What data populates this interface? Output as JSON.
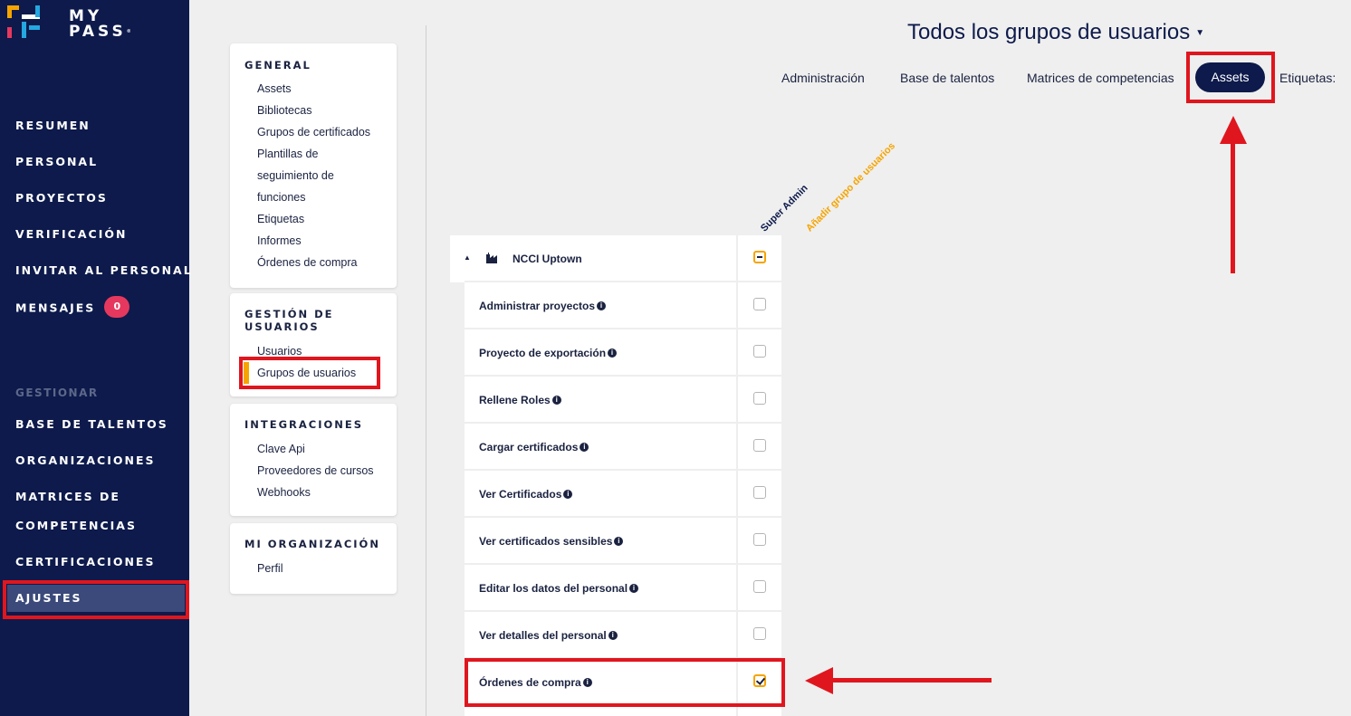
{
  "app": {
    "logo_line1": "MY",
    "logo_line2": "PASS"
  },
  "sidebar": {
    "items": [
      {
        "label": "RESUMEN"
      },
      {
        "label": "PERSONAL"
      },
      {
        "label": "PROYECTOS"
      },
      {
        "label": "VERIFICACIÓN"
      },
      {
        "label": "INVITAR AL PERSONAL"
      },
      {
        "label": "MENSAJES",
        "badge": "0"
      }
    ],
    "section_label": "GESTIONAR",
    "manage_items": [
      {
        "label": "BASE DE TALENTOS"
      },
      {
        "label": "ORGANIZACIONES"
      },
      {
        "label": "MATRICES DE"
      },
      {
        "label": "COMPETENCIAS"
      },
      {
        "label": "CERTIFICACIONES"
      },
      {
        "label": "AJUSTES",
        "active": true
      }
    ]
  },
  "settings_menu": {
    "general": {
      "title": "GENERAL",
      "links": [
        "Assets",
        "Bibliotecas",
        "Grupos de certificados",
        "Plantillas de",
        "seguimiento de",
        "funciones",
        "Etiquetas",
        "Informes",
        "Órdenes de compra"
      ]
    },
    "user_management": {
      "title_line1": "GESTIÓN DE",
      "title_line2": "USUARIOS",
      "links": [
        "Usuarios",
        "Grupos de usuarios"
      ],
      "active_link": "Grupos de usuarios"
    },
    "integrations": {
      "title": "INTEGRACIONES",
      "links": [
        "Clave Api",
        "Proveedores de cursos",
        "Webhooks"
      ]
    },
    "my_organization": {
      "title": "MI ORGANIZACIÓN",
      "links": [
        "Perfil"
      ]
    }
  },
  "header": {
    "title": "Todos los grupos de usuarios",
    "tabs": [
      "Administración",
      "Base de talentos",
      "Matrices de competencias",
      "Assets",
      "Etiquetas:"
    ],
    "active_tab": "Assets"
  },
  "permissions": {
    "columns": [
      "Super Admin",
      "Añadir grupo de usuarios"
    ],
    "group": {
      "name": "NCCI Uptown",
      "state": "indeterminate"
    },
    "rows": [
      {
        "label": "Administrar proyectos",
        "checked": false
      },
      {
        "label": "Proyecto de exportación",
        "checked": false
      },
      {
        "label": "Rellene Roles",
        "checked": false
      },
      {
        "label": "Cargar certificados",
        "checked": false
      },
      {
        "label": "Ver Certificados",
        "checked": false
      },
      {
        "label": "Ver certificados sensibles",
        "checked": false
      },
      {
        "label": "Editar los datos del personal",
        "checked": false
      },
      {
        "label": "Ver detalles del personal",
        "checked": false
      },
      {
        "label": "Órdenes de compra",
        "checked": true
      }
    ]
  },
  "colors": {
    "sidebar_bg": "#0d1a4b",
    "accent": "#f6a400",
    "highlight": "#e0161e",
    "badge": "#e6385e"
  }
}
